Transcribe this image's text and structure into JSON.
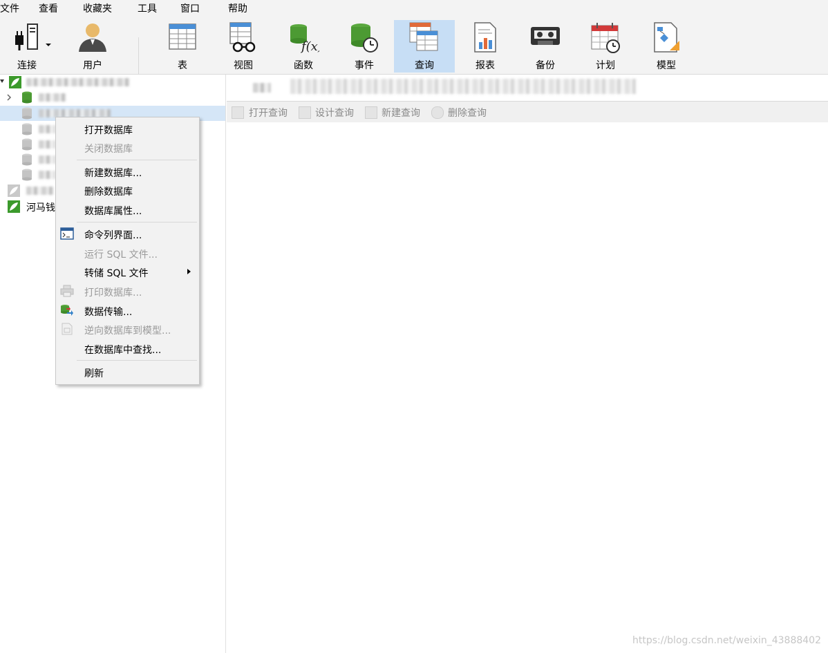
{
  "menu": [
    "文件",
    "查看",
    "收藏夹",
    "工具",
    "窗口",
    "帮助"
  ],
  "toolbar": {
    "connect": "连接",
    "user": "用户",
    "table": "表",
    "view": "视图",
    "function": "函数",
    "event": "事件",
    "query": "查询",
    "report": "报表",
    "backup": "备份",
    "schedule": "计划",
    "model": "模型",
    "active": "查询"
  },
  "tree": {
    "visible_label": "河马钱"
  },
  "subbar": {
    "open_query": "打开查询",
    "design_query": "设计查询",
    "new_query": "新建查询",
    "delete_query": "删除查询"
  },
  "context_menu": {
    "open_db": "打开数据库",
    "close_db": "关闭数据库",
    "new_db": "新建数据库...",
    "delete_db": "删除数据库",
    "db_props": "数据库属性...",
    "console": "命令列界面...",
    "run_sql": "运行 SQL 文件...",
    "dump_sql": "转储 SQL 文件",
    "print_db": "打印数据库...",
    "data_transfer": "数据传输...",
    "reverse_model": "逆向数据库到模型...",
    "find_in_db": "在数据库中查找...",
    "refresh": "刷新"
  },
  "watermark": "https://blog.csdn.net/weixin_43888402",
  "colors": {
    "accent_selected": "#c7def5",
    "tree_selected": "#d5e6f7",
    "disabled_text": "#9a9a9a",
    "db_green": "#4caf3a"
  }
}
